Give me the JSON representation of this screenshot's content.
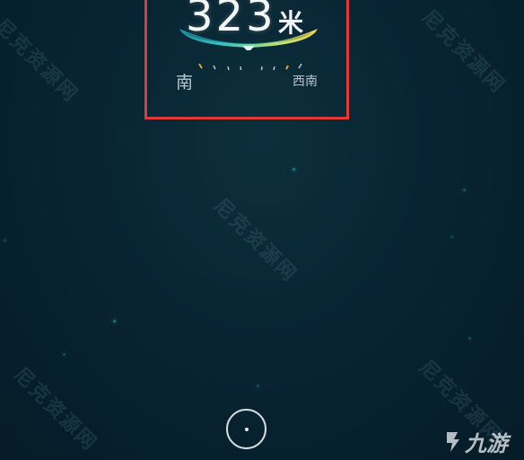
{
  "distance": {
    "value": "323",
    "unit": "米"
  },
  "compass": {
    "left_direction": "南",
    "right_direction": "西南"
  },
  "watermarks": [
    "尼克资源网",
    "尼克资源网",
    "尼克资源网",
    "尼克资源网",
    "尼克资源网"
  ],
  "brand": {
    "logo_text": "九游"
  },
  "colors": {
    "background": "#082433",
    "highlight": "#e0393a",
    "arc_gradient_start": "#2fb6c0",
    "arc_gradient_end": "#f6d34a"
  }
}
